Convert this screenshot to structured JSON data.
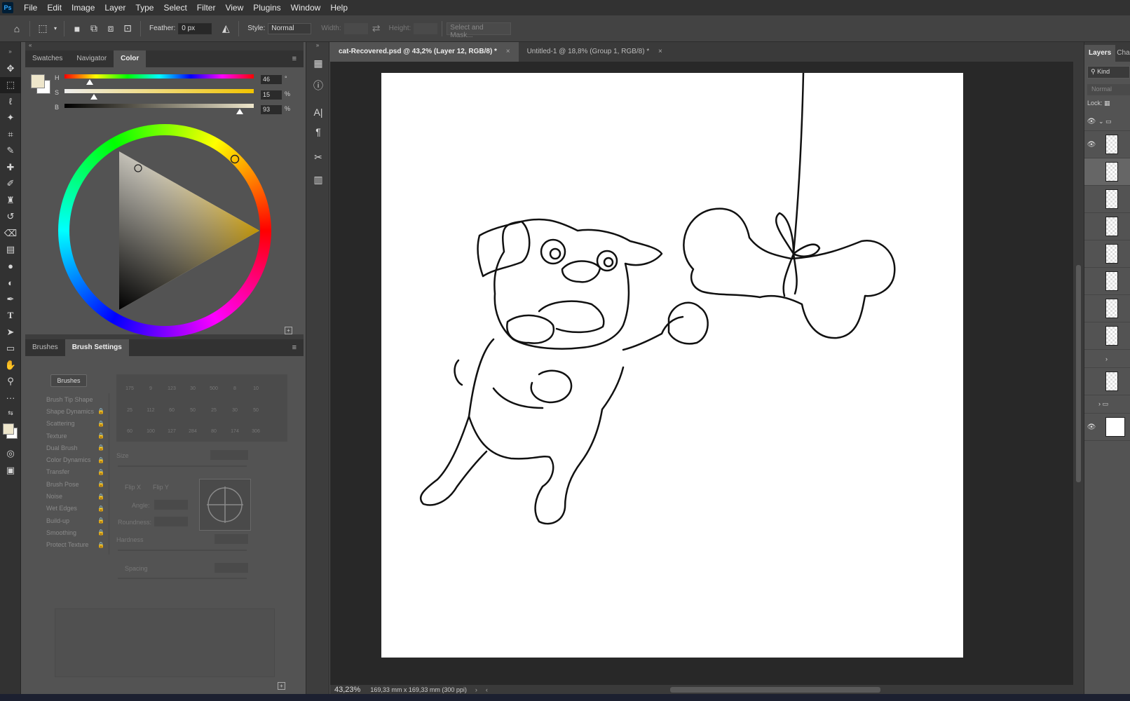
{
  "app": {
    "logo": "Ps"
  },
  "menu": [
    "File",
    "Edit",
    "Image",
    "Layer",
    "Type",
    "Select",
    "Filter",
    "View",
    "Plugins",
    "Window",
    "Help"
  ],
  "options": {
    "feather_label": "Feather:",
    "feather_value": "0 px",
    "style_label": "Style:",
    "style_value": "Normal",
    "width_label": "Width:",
    "height_label": "Height:",
    "select_mask": "Select and Mask..."
  },
  "color_panel": {
    "tabs": [
      "Swatches",
      "Navigator",
      "Color"
    ],
    "active_tab": "Color",
    "h_label": "H",
    "h_value": "46",
    "h_unit": "°",
    "s_label": "S",
    "s_value": "15",
    "s_unit": "%",
    "b_label": "B",
    "b_value": "93",
    "b_unit": "%",
    "foreground_color": "#eee6cb",
    "background_color": "#ffffff"
  },
  "brush_panel": {
    "tabs": [
      "Brushes",
      "Brush Settings"
    ],
    "active_tab": "Brush Settings",
    "brushes_button": "Brushes",
    "settings": [
      "Brush Tip Shape",
      "Shape Dynamics",
      "Scattering",
      "Texture",
      "Dual Brush",
      "Color Dynamics",
      "Transfer",
      "Brush Pose",
      "Noise",
      "Wet Edges",
      "Build-up",
      "Smoothing",
      "Protect Texture"
    ],
    "brush_sizes": [
      "175",
      "9",
      "123",
      "30",
      "500",
      "8",
      "10",
      "25",
      "112",
      "60",
      "50",
      "25",
      "30",
      "50",
      "60",
      "100",
      "127",
      "284",
      "80",
      "174",
      "306"
    ],
    "size_label": "Size",
    "flipx_label": "Flip X",
    "flipy_label": "Flip Y",
    "angle_label": "Angle:",
    "roundness_label": "Roundness:",
    "hardness_label": "Hardness",
    "spacing_label": "Spacing"
  },
  "doc_tabs": [
    {
      "label": "cat-Recovered.psd @ 43,2% (Layer 12, RGB/8) *",
      "active": true
    },
    {
      "label": "Untitled-1 @ 18,8% (Group 1, RGB/8) *",
      "active": false
    }
  ],
  "status": {
    "zoom": "43,23%",
    "doc_info": "169,33 mm x 169,33 mm (300 ppi)"
  },
  "layers": {
    "tabs": [
      "Layers",
      "Cha"
    ],
    "kind_label": "Kind",
    "blend_mode": "Normal",
    "lock_label": "Lock:"
  }
}
